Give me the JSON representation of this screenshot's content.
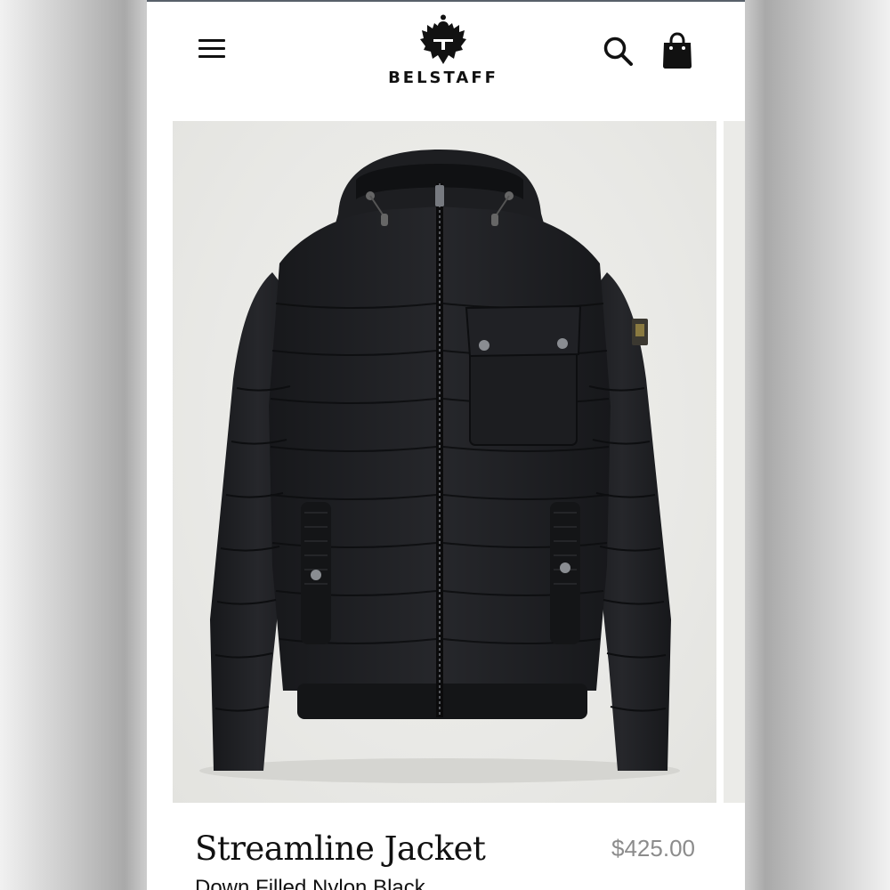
{
  "header": {
    "menu_icon": "hamburger-menu-icon",
    "brand": "BELSTAFF",
    "logo_icon": "phoenix-logo-icon",
    "search_icon": "search-icon",
    "bag_icon": "shopping-bag-icon"
  },
  "product": {
    "name": "Streamline Jacket",
    "price": "$425.00",
    "subtitle": "Down Filled Nylon Black"
  },
  "colors": {
    "text": "#111111",
    "price": "#8c8c8c",
    "image_background": "#e9e9e6",
    "jacket": "#1e1f22"
  }
}
